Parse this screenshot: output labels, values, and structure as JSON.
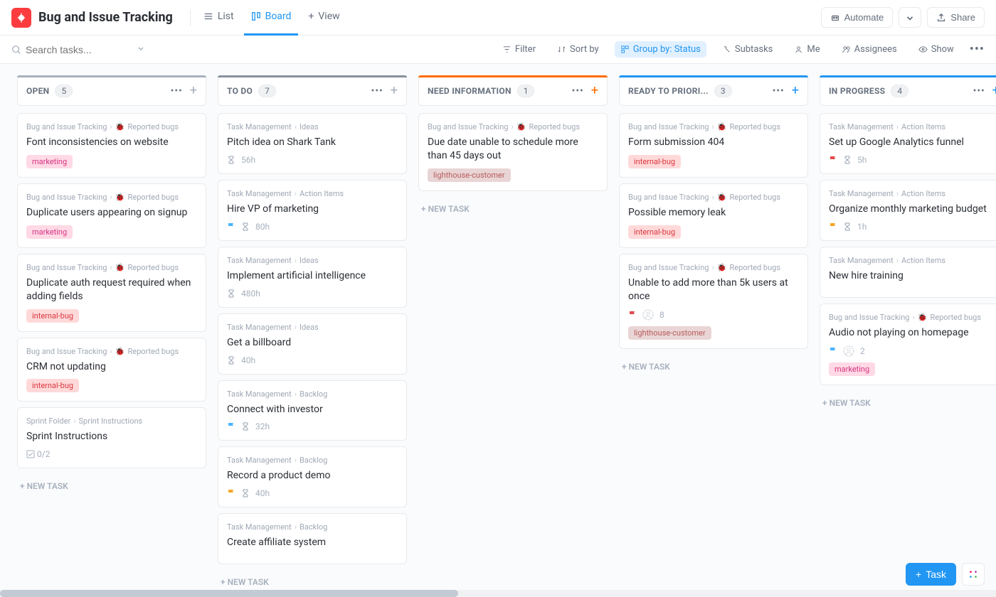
{
  "header": {
    "title": "Bug and Issue Tracking",
    "views": {
      "list": "List",
      "board": "Board",
      "add": "View"
    },
    "automate": "Automate",
    "share": "Share"
  },
  "toolbar": {
    "search_placeholder": "Search tasks...",
    "filter": "Filter",
    "sort": "Sort by",
    "group": "Group by: Status",
    "subtasks": "Subtasks",
    "me": "Me",
    "assignees": "Assignees",
    "show": "Show"
  },
  "columns": [
    {
      "title": "OPEN",
      "count": 5,
      "bar": "bar-gray",
      "plusClass": "",
      "cards": [
        {
          "crumb": [
            "Bug and Issue Tracking",
            "Reported bugs"
          ],
          "bug": true,
          "title": "Font inconsistencies on website",
          "tags": [
            {
              "t": "marketing",
              "c": "tag-marketing"
            }
          ]
        },
        {
          "crumb": [
            "Bug and Issue Tracking",
            "Reported bugs"
          ],
          "bug": true,
          "title": "Duplicate users appearing on signup",
          "tags": [
            {
              "t": "marketing",
              "c": "tag-marketing"
            }
          ]
        },
        {
          "crumb": [
            "Bug and Issue Tracking",
            "Reported bugs"
          ],
          "bug": true,
          "title": "Duplicate auth request required when adding fields",
          "tags": [
            {
              "t": "internal-bug",
              "c": "tag-internal"
            }
          ]
        },
        {
          "crumb": [
            "Bug and Issue Tracking",
            "Reported bugs"
          ],
          "bug": true,
          "title": "CRM not updating",
          "tags": [
            {
              "t": "internal-bug",
              "c": "tag-internal"
            }
          ]
        },
        {
          "crumb": [
            "Sprint Folder",
            "Sprint Instructions"
          ],
          "bug": false,
          "title": "Sprint Instructions",
          "subtask": "0/2"
        }
      ]
    },
    {
      "title": "TO DO",
      "count": 7,
      "bar": "bar-gray2",
      "plusClass": "",
      "cards": [
        {
          "crumb": [
            "Task Management",
            "Ideas"
          ],
          "title": "Pitch idea on Shark Tank",
          "time": "56h"
        },
        {
          "crumb": [
            "Task Management",
            "Action Items"
          ],
          "title": "Hire VP of marketing",
          "flag": "blue",
          "time": "80h"
        },
        {
          "crumb": [
            "Task Management",
            "Ideas"
          ],
          "title": "Implement artificial intelligence",
          "time": "480h"
        },
        {
          "crumb": [
            "Task Management",
            "Ideas"
          ],
          "title": "Get a billboard",
          "time": "40h"
        },
        {
          "crumb": [
            "Task Management",
            "Backlog"
          ],
          "title": "Connect with investor",
          "flag": "blue",
          "time": "32h"
        },
        {
          "crumb": [
            "Task Management",
            "Backlog"
          ],
          "title": "Record a product demo",
          "flag": "yellow",
          "time": "40h"
        },
        {
          "crumb": [
            "Task Management",
            "Backlog"
          ],
          "title": "Create affiliate system"
        }
      ]
    },
    {
      "title": "NEED INFORMATION",
      "count": 1,
      "bar": "bar-orange",
      "plusClass": "orange",
      "cards": [
        {
          "crumb": [
            "Bug and Issue Tracking",
            "Reported bugs"
          ],
          "bug": true,
          "title": "Due date unable to schedule more than 45 days out",
          "tags": [
            {
              "t": "lighthouse-customer",
              "c": "tag-lighthouse"
            }
          ]
        }
      ]
    },
    {
      "title": "READY TO PRIORI...",
      "count": 3,
      "bar": "bar-blue",
      "plusClass": "blue",
      "cards": [
        {
          "crumb": [
            "Bug and Issue Tracking",
            "Reported bugs"
          ],
          "bug": true,
          "title": "Form submission 404",
          "tags": [
            {
              "t": "internal-bug",
              "c": "tag-internal"
            }
          ]
        },
        {
          "crumb": [
            "Bug and Issue Tracking",
            "Reported bugs"
          ],
          "bug": true,
          "title": "Possible memory leak",
          "tags": [
            {
              "t": "internal-bug",
              "c": "tag-internal"
            }
          ]
        },
        {
          "crumb": [
            "Bug and Issue Tracking",
            "Reported bugs"
          ],
          "bug": true,
          "title": "Unable to add more than 5k users at once",
          "flag": "red",
          "avatarCount": "8",
          "tags": [
            {
              "t": "lighthouse-customer",
              "c": "tag-lighthouse"
            }
          ]
        }
      ]
    },
    {
      "title": "IN PROGRESS",
      "count": 4,
      "bar": "bar-cyan",
      "plusClass": "blue",
      "cards": [
        {
          "crumb": [
            "Task Management",
            "Action Items"
          ],
          "title": "Set up Google Analytics funnel",
          "flag": "red",
          "time": "5h"
        },
        {
          "crumb": [
            "Task Management",
            "Action Items"
          ],
          "title": "Organize monthly marketing budget",
          "flag": "yellow",
          "time": "1h"
        },
        {
          "crumb": [
            "Task Management",
            "Action Items"
          ],
          "title": "New hire training"
        },
        {
          "crumb": [
            "Bug and Issue Tracking",
            "Reported bugs"
          ],
          "bug": true,
          "title": "Audio not playing on homepage",
          "flag": "blue",
          "avatarCount": "2",
          "tags": [
            {
              "t": "marketing",
              "c": "tag-marketing"
            }
          ]
        }
      ]
    }
  ],
  "newTask": "+ NEW TASK",
  "fab": {
    "task": "Task"
  }
}
